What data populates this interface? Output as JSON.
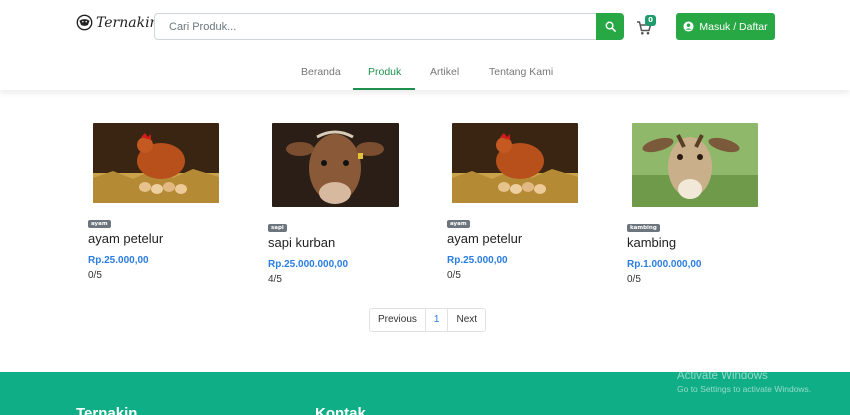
{
  "header": {
    "brand": "Ternakin",
    "search_placeholder": "Cari Produk...",
    "cart_count": "0",
    "login_label": "Masuk / Daftar",
    "accent": "#28a745"
  },
  "nav": {
    "items": [
      "Beranda",
      "Produk",
      "Artikel",
      "Tentang Kami"
    ],
    "active": "Produk"
  },
  "products": [
    {
      "category": "ayam",
      "name": "ayam petelur",
      "price": "Rp.25.000,00",
      "rating": "0/5"
    },
    {
      "category": "sapi",
      "name": "sapi kurban",
      "price": "Rp.25.000.000,00",
      "rating": "4/5"
    },
    {
      "category": "ayam",
      "name": "ayam petelur",
      "price": "Rp.25.000,00",
      "rating": "0/5"
    },
    {
      "category": "kambing",
      "name": "kambing",
      "price": "Rp.1.000.000,00",
      "rating": "0/5"
    }
  ],
  "pagination": {
    "previous": "Previous",
    "current": "1",
    "next": "Next"
  },
  "footer": {
    "col1_title": "Ternakin",
    "col2_title": "Kontak",
    "background": "#10ae86"
  },
  "watermark": {
    "line1": "Activate Windows",
    "line2": "Go to Settings to activate Windows."
  }
}
